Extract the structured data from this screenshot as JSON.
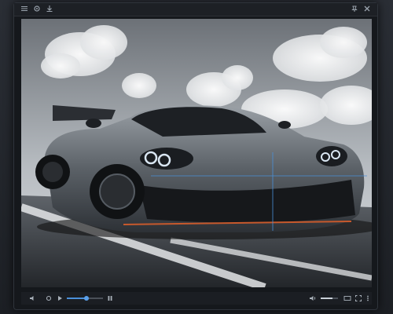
{
  "window": {
    "title": ""
  },
  "titlebar": {
    "left_icons": [
      "menu-icon",
      "gear-icon",
      "download-icon"
    ],
    "right_icons": [
      "pin-icon",
      "close-icon"
    ]
  },
  "media": {
    "subject": "image-viewport",
    "accent_color": "#4a90d9"
  },
  "controls": {
    "progress": 0.55,
    "volume": 0.7,
    "elapsed": "",
    "duration": "",
    "buttons": [
      "play-icon",
      "volume-icon",
      "fullscreen-icon",
      "settings-icon"
    ]
  },
  "colors": {
    "frame": "#1a1d22",
    "window": "#15181c",
    "accent": "#4a90d9"
  }
}
